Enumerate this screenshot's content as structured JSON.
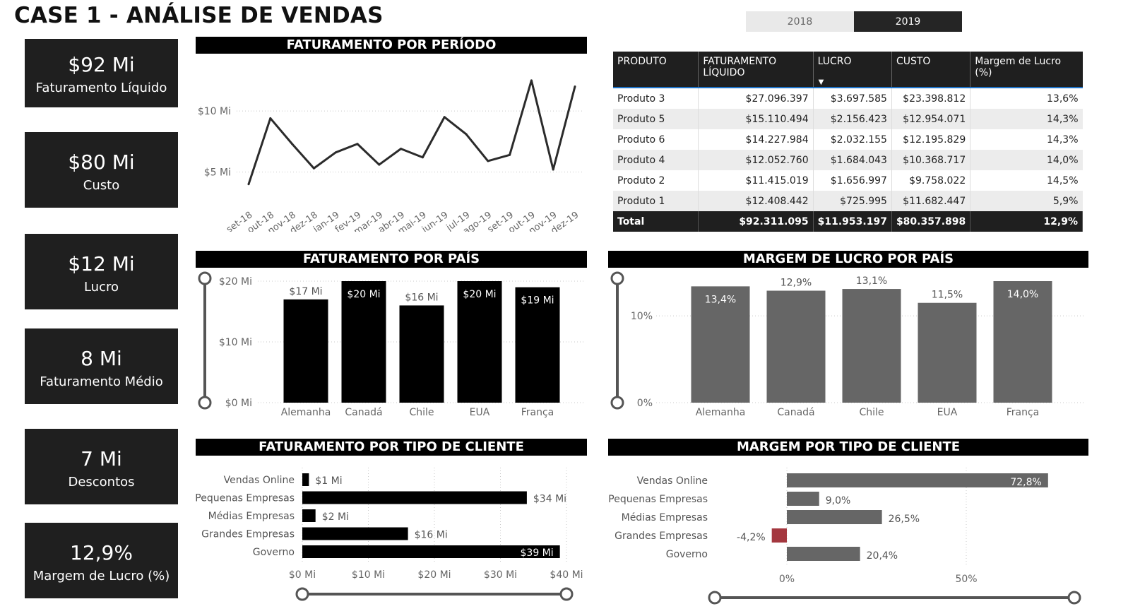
{
  "page_title": "CASE 1 - ANÁLISE DE VENDAS",
  "year_slicer": [
    "2018",
    "2019"
  ],
  "selected_year": "2019",
  "kpis": [
    {
      "value": "$92 Mi",
      "label": "Faturamento Líquido"
    },
    {
      "value": "$80 Mi",
      "label": "Custo"
    },
    {
      "value": "$12 Mi",
      "label": "Lucro"
    },
    {
      "value": "8 Mi",
      "label": "Faturamento Médio"
    },
    {
      "value": "7 Mi",
      "label": "Descontos"
    },
    {
      "value": "12,9%",
      "label": "Margem de Lucro (%)"
    }
  ],
  "product_table": {
    "columns": [
      "PRODUTO",
      "FATURAMENTO LÍQUIDO",
      "LUCRO",
      "CUSTO",
      "Margem de Lucro (%)"
    ],
    "rows": [
      [
        "Produto 3",
        "$27.096.397",
        "$3.697.585",
        "$23.398.812",
        "13,6%"
      ],
      [
        "Produto 5",
        "$15.110.494",
        "$2.156.423",
        "$12.954.071",
        "14,3%"
      ],
      [
        "Produto 6",
        "$14.227.984",
        "$2.032.155",
        "$12.195.829",
        "14,3%"
      ],
      [
        "Produto 4",
        "$12.052.760",
        "$1.684.043",
        "$10.368.717",
        "14,0%"
      ],
      [
        "Produto 2",
        "$11.415.019",
        "$1.656.997",
        "$9.758.022",
        "14,5%"
      ],
      [
        "Produto 1",
        "$12.408.442",
        "$725.995",
        "$11.682.447",
        "5,9%"
      ]
    ],
    "total": [
      "Total",
      "$92.311.095",
      "$11.953.197",
      "$80.357.898",
      "12,9%"
    ]
  },
  "chart_data": [
    {
      "type": "line",
      "title": "FATURAMENTO POR PERÍODO",
      "x": [
        "set-18",
        "out-18",
        "nov-18",
        "dez-18",
        "jan-19",
        "fev-19",
        "mar-19",
        "abr-19",
        "mai-19",
        "jun-19",
        "jul-19",
        "ago-19",
        "set-19",
        "out-19",
        "nov-19",
        "dez-19"
      ],
      "values": [
        4.0,
        9.4,
        7.3,
        5.3,
        6.6,
        7.3,
        5.6,
        6.9,
        6.2,
        9.5,
        8.1,
        5.9,
        6.4,
        12.5,
        5.2,
        12.0
      ],
      "y_ticks": [
        "$5 Mi",
        "$10 Mi"
      ],
      "ylim": [
        3,
        14
      ],
      "grid": true,
      "color": "#2b2b2b"
    },
    {
      "type": "bar",
      "title": "FATURAMENTO POR PAÍS",
      "categories": [
        "Alemanha",
        "Canadá",
        "Chile",
        "EUA",
        "França"
      ],
      "values": [
        17,
        20,
        16,
        20,
        19
      ],
      "labels": [
        "$17 Mi",
        "$20 Mi",
        "$16 Mi",
        "$20 Mi",
        "$19 Mi"
      ],
      "y_ticks": [
        "$0 Mi",
        "$10 Mi",
        "$20 Mi"
      ],
      "ylim": [
        0,
        20
      ],
      "color": "#000000"
    },
    {
      "type": "bar",
      "title": "MARGEM DE LUCRO POR PAÍS",
      "categories": [
        "Alemanha",
        "Canadá",
        "Chile",
        "EUA",
        "França"
      ],
      "values": [
        13.4,
        12.9,
        13.1,
        11.5,
        14.0
      ],
      "labels": [
        "13,4%",
        "12,9%",
        "13,1%",
        "11,5%",
        "14,0%"
      ],
      "y_ticks": [
        "0%",
        "10%"
      ],
      "ylim": [
        0,
        14
      ],
      "color": "#666666"
    },
    {
      "type": "bar",
      "orientation": "horizontal",
      "title": "FATURAMENTO POR TIPO DE CLIENTE",
      "categories": [
        "Vendas Online",
        "Pequenas Empresas",
        "Médias Empresas",
        "Grandes Empresas",
        "Governo"
      ],
      "values": [
        1,
        34,
        2,
        16,
        39
      ],
      "labels": [
        "$1 Mi",
        "$34 Mi",
        "$2 Mi",
        "$16 Mi",
        "$39 Mi"
      ],
      "x_ticks": [
        "$0 Mi",
        "$10 Mi",
        "$20 Mi",
        "$30 Mi",
        "$40 Mi"
      ],
      "xlim": [
        0,
        40
      ],
      "color": "#000000"
    },
    {
      "type": "bar",
      "orientation": "horizontal",
      "title": "MARGEM POR TIPO DE CLIENTE",
      "categories": [
        "Vendas Online",
        "Pequenas Empresas",
        "Médias Empresas",
        "Grandes Empresas",
        "Governo"
      ],
      "values": [
        72.8,
        9.0,
        26.5,
        -4.2,
        20.4
      ],
      "labels": [
        "72,8%",
        "9,0%",
        "26,5%",
        "-4,2%",
        "20,4%"
      ],
      "x_ticks": [
        "0%",
        "50%"
      ],
      "xlim": [
        -10,
        80
      ],
      "color": "#666666",
      "negative_color": "#a4373f"
    }
  ]
}
